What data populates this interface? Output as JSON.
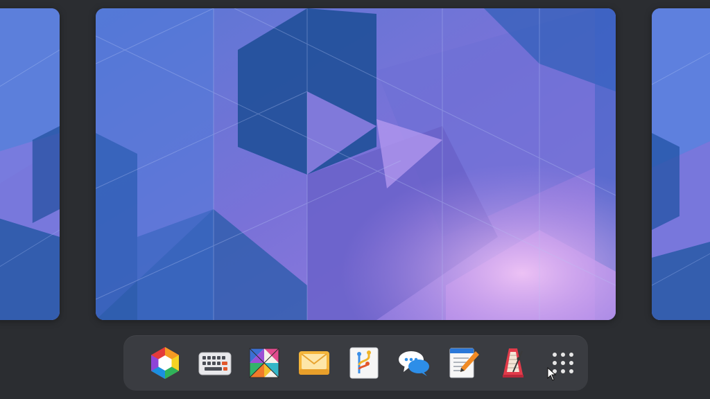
{
  "theme": {
    "background": "#2b2d31",
    "dock_background": "#3a3c41",
    "wallpaper_dark": "#24519c",
    "wallpaper_mid": "#6f6cd2",
    "wallpaper_light": "#c49af0"
  },
  "workspaces": [
    {
      "name": "previous-workspace"
    },
    {
      "name": "current-workspace"
    },
    {
      "name": "next-workspace"
    }
  ],
  "dock": {
    "items": [
      {
        "icon": "app-center-icon"
      },
      {
        "icon": "keyboard-icon"
      },
      {
        "icon": "tangram-icon"
      },
      {
        "icon": "mail-icon"
      },
      {
        "icon": "git-icon"
      },
      {
        "icon": "chat-icon"
      },
      {
        "icon": "text-editor-icon"
      },
      {
        "icon": "metronome-icon"
      },
      {
        "icon": "app-grid-icon"
      }
    ]
  }
}
